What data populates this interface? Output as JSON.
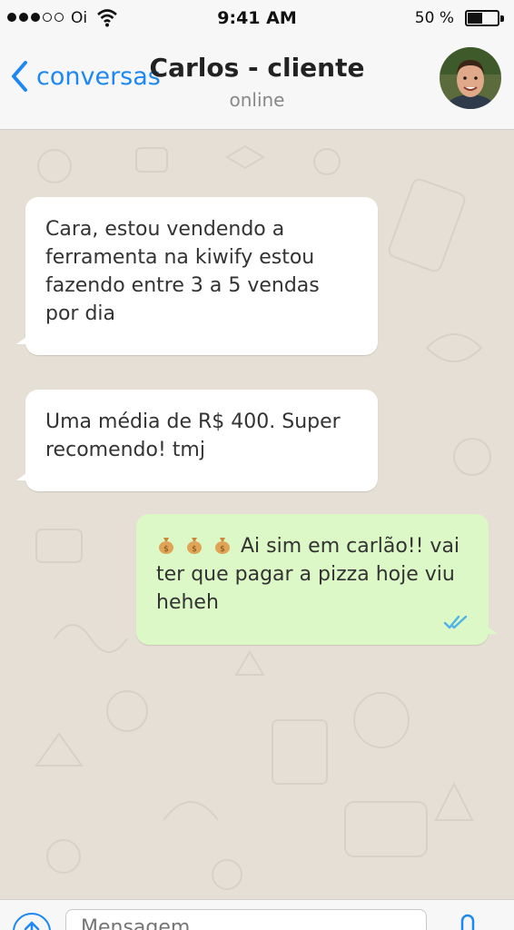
{
  "status_bar": {
    "carrier": "Oi",
    "time": "9:41 AM",
    "battery_percent": "50 %",
    "battery_level": 0.5,
    "signal_dots_filled": 3,
    "signal_dots_total": 5
  },
  "header": {
    "back_label": "conversas",
    "contact_name": "Carlos - cliente",
    "contact_status": "online",
    "accent_color": "#1e88f2"
  },
  "messages": [
    {
      "direction": "incoming",
      "lines": [
        "Cara, estou vendendo a",
        "ferramenta na kiwify estou",
        "fazendo entre 3 a 5 vendas",
        "por dia"
      ]
    },
    {
      "direction": "incoming",
      "lines": [
        "Uma média de R$ 400. Super",
        "recomendo! tmj"
      ]
    },
    {
      "direction": "outgoing",
      "emoji": [
        "money-bag-icon",
        "money-bag-icon",
        "money-bag-icon"
      ],
      "line1": "Ai sim em carlão!! vai",
      "line2": "ter que pagar a pizza hoje viu",
      "line3": "heheh",
      "status": "read"
    }
  ],
  "composer": {
    "placeholder": "Mensagem"
  },
  "colors": {
    "incoming_bubble": "#ffffff",
    "outgoing_bubble": "#dcf8c6",
    "read_ticks": "#4fb3e8",
    "chat_background": "#e6dfd5"
  }
}
